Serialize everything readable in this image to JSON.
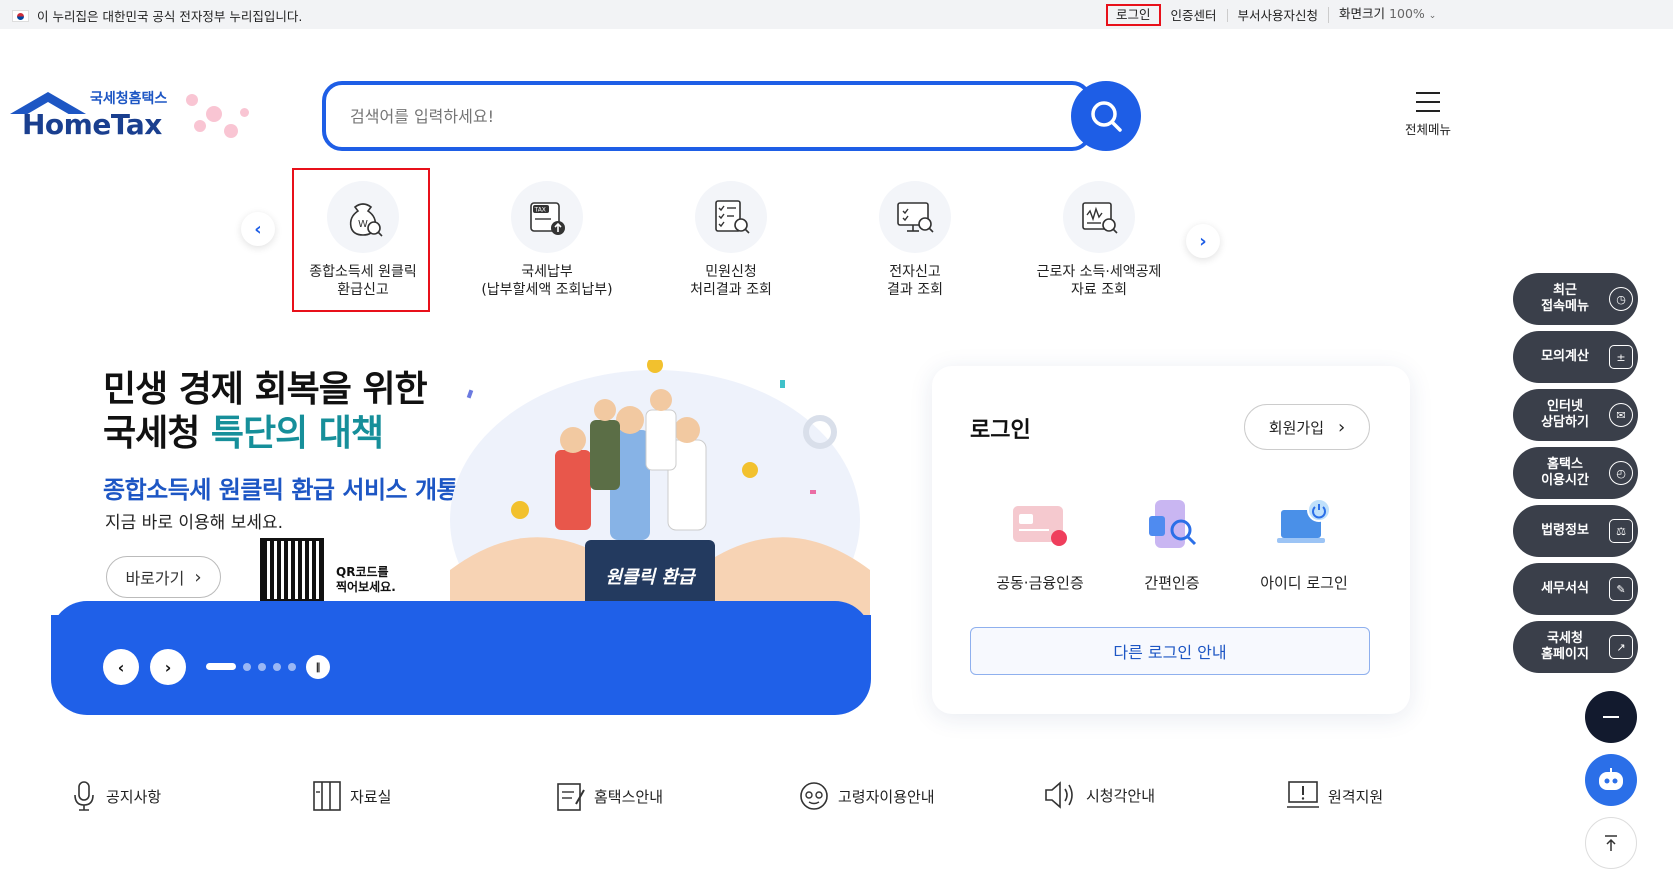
{
  "topbar": {
    "gov_notice": "이 누리집은 대한민국 공식 전자정부 누리집입니다.",
    "links": [
      "로그인",
      "인증센터",
      "부서사용자신청"
    ],
    "zoom_label": "화면크기",
    "zoom_value": "100%"
  },
  "header": {
    "brand_ko": "국세청홈택스",
    "brand_en": "HomeTax",
    "search_placeholder": "검색어를 입력하세요!",
    "allmenu_label": "전체메뉴"
  },
  "quick_menu": [
    {
      "line1": "종합소득세 원클릭",
      "line2": "환급신고",
      "icon": "money-bag-search-icon"
    },
    {
      "line1": "국세납부",
      "line2": "(납부할세액 조회납부)",
      "icon": "tax-document-upload-icon"
    },
    {
      "line1": "민원신청",
      "line2": "처리결과 조회",
      "icon": "checklist-search-icon"
    },
    {
      "line1": "전자신고",
      "line2": "결과 조회",
      "icon": "monitor-search-icon"
    },
    {
      "line1": "근로자 소득·세액공제",
      "line2": "자료 조회",
      "icon": "receipt-search-icon"
    }
  ],
  "banner": {
    "line1": "민생 경제 회복을 위한",
    "line2_plain": "국세청 ",
    "line2_highlight": "특단의 대책",
    "subtitle": "종합소득세 원클릭 환급 서비스 개통",
    "desc": "지금 바로 이용해 보세요.",
    "go_label": "바로가기",
    "qr_text_1": "QR코드를",
    "qr_text_2": "찍어보세요.",
    "sign_text": "원클릭 환급",
    "slide_count": 6,
    "active_slide": 1
  },
  "login": {
    "title": "로그인",
    "join_label": "회원가입",
    "options": [
      "공동·금융인증",
      "간편인증",
      "아이디 로그인"
    ],
    "other_label": "다른 로그인 안내"
  },
  "right_quick": [
    {
      "l1": "최근",
      "l2": "접속메뉴",
      "icon": "clock-icon"
    },
    {
      "l1": "모의계산",
      "l2": "",
      "icon": "calculator-icon"
    },
    {
      "l1": "인터넷",
      "l2": "상담하기",
      "icon": "headset-icon"
    },
    {
      "l1": "홈택스",
      "l2": "이용시간",
      "icon": "alarm-icon"
    },
    {
      "l1": "법령정보",
      "l2": "",
      "icon": "gavel-icon"
    },
    {
      "l1": "세무서식",
      "l2": "",
      "icon": "form-edit-icon"
    },
    {
      "l1": "국세청",
      "l2": "홈페이지",
      "icon": "building-link-icon"
    }
  ],
  "bottom_links": [
    "공지사항",
    "자료실",
    "홈택스안내",
    "고령자이용안내",
    "시청각안내",
    "원격지원"
  ],
  "colors": {
    "primary": "#1e5ee6",
    "highlight": "#e8101a",
    "dark": "#3a3f4a",
    "teal": "#168f9a"
  }
}
